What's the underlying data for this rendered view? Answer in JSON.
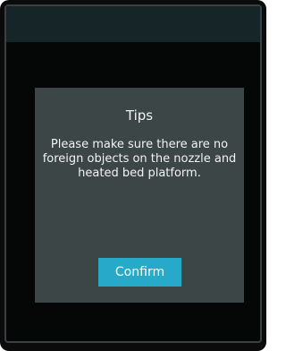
{
  "dialog": {
    "title": "Tips",
    "message": "Please make sure there are no foreign objects on the nozzle and heated bed platform.",
    "confirm_label": "Confirm"
  },
  "colors": {
    "screen_background": "#050707",
    "top_bar": "#162528",
    "dialog_background": "#3d4647",
    "accent": "#27a9c9"
  }
}
